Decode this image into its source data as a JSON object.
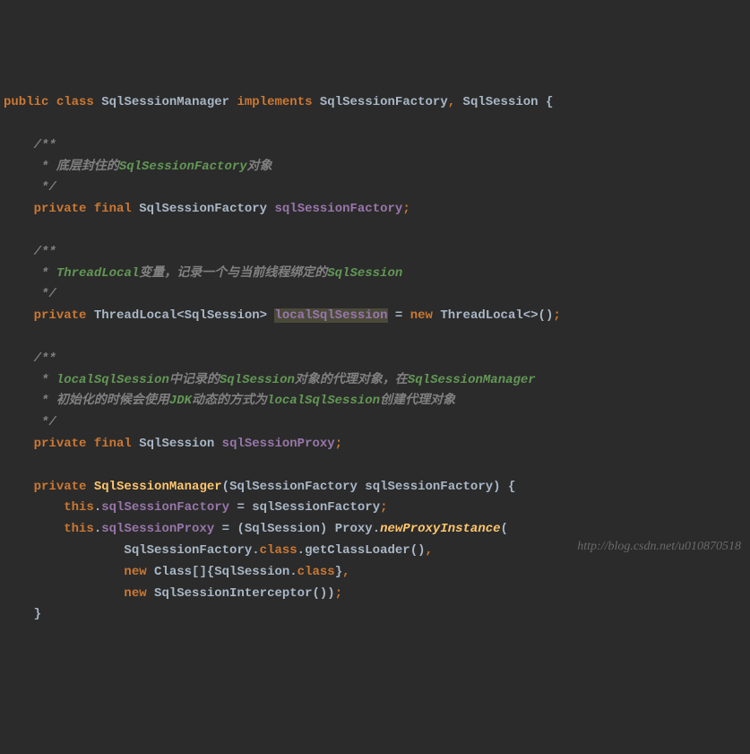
{
  "code": {
    "l1_kw1": "public",
    "l1_kw2": "class",
    "l1_classname": "SqlSessionManager",
    "l1_kw3": "implements",
    "l1_iface1": "SqlSessionFactory",
    "l1_iface2": "SqlSession",
    "l1_brace": "{",
    "c1_open": "/**",
    "c1_line": " * 底层封住的",
    "c1_em": "SqlSessionFactory",
    "c1_tail": "对象",
    "c1_close": " */",
    "l4_kw1": "private",
    "l4_kw2": "final",
    "l4_type": "SqlSessionFactory",
    "l4_field": "sqlSessionFactory",
    "l4_semi": ";",
    "c2_open": "/**",
    "c2_prefix": " * ",
    "c2_em1": "ThreadLocal",
    "c2_mid": "变量，记录一个与当前线程绑定的",
    "c2_em2": "SqlSession",
    "c2_close": " */",
    "l8_kw1": "private",
    "l8_type1": "ThreadLocal<SqlSession>",
    "l8_field": "localSqlSession",
    "l8_eq": " = ",
    "l8_kw2": "new",
    "l8_type2": "ThreadLocal<>()",
    "l8_semi": ";",
    "c3_open": "/**",
    "c3_p1": " * ",
    "c3_em1": "localSqlSession",
    "c3_t1": "中记录的",
    "c3_em2": "SqlSession",
    "c3_t2": "对象的代理对象，在",
    "c3_em3": "SqlSessionManager",
    "c3_p2": " * 初始化的时候会使用",
    "c3_em4": "JDK",
    "c3_t3": "动态的方式为",
    "c3_em5": "localSqlSession",
    "c3_t4": "创建代理对象",
    "c3_close": " */",
    "l14_kw1": "private",
    "l14_kw2": "final",
    "l14_type": "SqlSession",
    "l14_field": "sqlSessionProxy",
    "l14_semi": ";",
    "l16_kw1": "private",
    "l16_ctor": "SqlSessionManager",
    "l16_ptype": "SqlSessionFactory",
    "l16_pname": "sqlSessionFactory",
    "l16_brace": "{",
    "l17_kw": "this",
    "l17_field": "sqlSessionFactory",
    "l17_eq": " = sqlSessionFactory",
    "l17_semi": ";",
    "l18_kw": "this",
    "l18_field": "sqlSessionProxy",
    "l18_eq": " = (SqlSession) Proxy.",
    "l18_call": "newProxyInstance",
    "l18_open": "(",
    "l19_t1": "SqlSessionFactory.",
    "l19_kw": "class",
    "l19_t2": ".getClassLoader()",
    "l19_comma": ",",
    "l20_kw1": "new",
    "l20_t1": " Class[]{SqlSession.",
    "l20_kw2": "class",
    "l20_t2": "}",
    "l20_comma": ",",
    "l21_kw": "new",
    "l21_t1": " SqlSessionInterceptor())",
    "l21_semi": ";",
    "l22_brace": "}"
  },
  "watermark": "http://blog.csdn.net/u010870518"
}
